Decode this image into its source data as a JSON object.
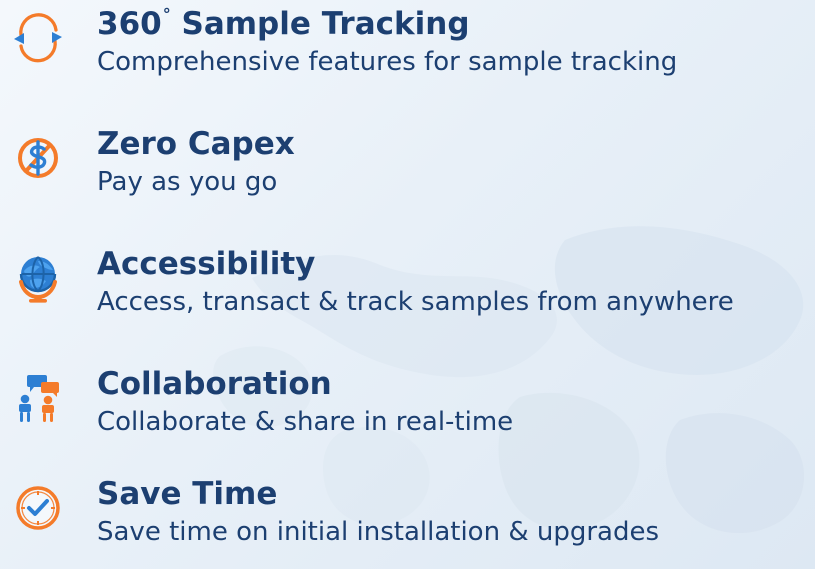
{
  "colors": {
    "title_text": "#1c3f71",
    "accent_orange": "#f47b2a",
    "accent_blue": "#2d7fd3",
    "background": "#e9f1f8"
  },
  "features": [
    {
      "icon": "circular-arrows-icon",
      "title": "360",
      "title_symbol": "°",
      "title_suffix": " Sample Tracking",
      "description": "Comprehensive features for sample tracking"
    },
    {
      "icon": "no-dollar-icon",
      "title": "Zero Capex",
      "description": "Pay as you go"
    },
    {
      "icon": "globe-icon",
      "title": "Accessibility",
      "description": "Access, transact & track samples from anywhere"
    },
    {
      "icon": "collaboration-icon",
      "title": "Collaboration",
      "description": "Collaborate & share in real-time"
    },
    {
      "icon": "clock-icon",
      "title": "Save Time",
      "description": "Save time on initial installation & upgrades"
    }
  ]
}
